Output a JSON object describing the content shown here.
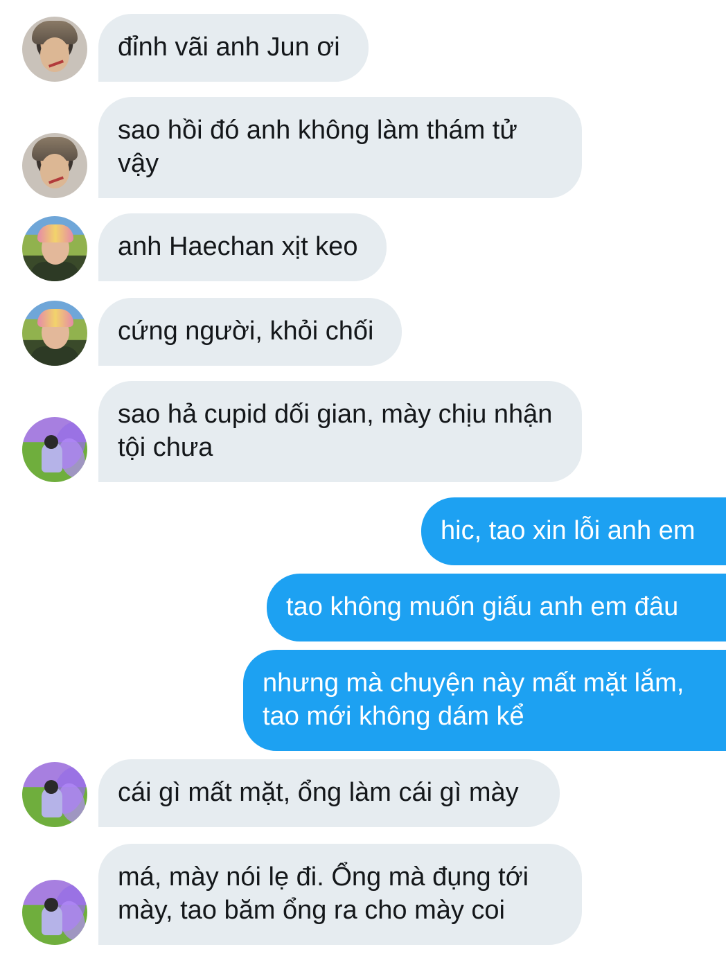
{
  "messages": [
    {
      "direction": "in",
      "avatar": "avatar-jun",
      "text": "đỉnh vãi anh Jun ơi"
    },
    {
      "direction": "in",
      "avatar": "avatar-jun",
      "text": "sao hồi đó anh không làm thám tử vậy"
    },
    {
      "direction": "in",
      "avatar": "avatar-haechan",
      "text": "anh Haechan xịt keo"
    },
    {
      "direction": "in",
      "avatar": "avatar-haechan",
      "text": "cứng người, khỏi chối"
    },
    {
      "direction": "in",
      "avatar": "avatar-fairy",
      "text": "sao hả cupid dối gian, mày chịu nhận tội chưa"
    },
    {
      "direction": "out",
      "text": "hic, tao xin lỗi anh em"
    },
    {
      "direction": "out",
      "text": "tao không muốn giấu anh em đâu"
    },
    {
      "direction": "out",
      "text": "nhưng mà chuyện này mất mặt lắm, tao mới không dám kể"
    },
    {
      "direction": "in",
      "avatar": "avatar-fairy",
      "text": "cái gì mất mặt, ổng làm cái gì mày"
    },
    {
      "direction": "in",
      "avatar": "avatar-fairy",
      "text": "má, mày nói lẹ đi. Ổng mà đụng tới mày, tao băm ổng ra cho mày coi"
    }
  ],
  "colors": {
    "incoming_bubble": "#e6ecf0",
    "outgoing_bubble": "#1da1f2",
    "incoming_text": "#14171a",
    "outgoing_text": "#ffffff"
  }
}
